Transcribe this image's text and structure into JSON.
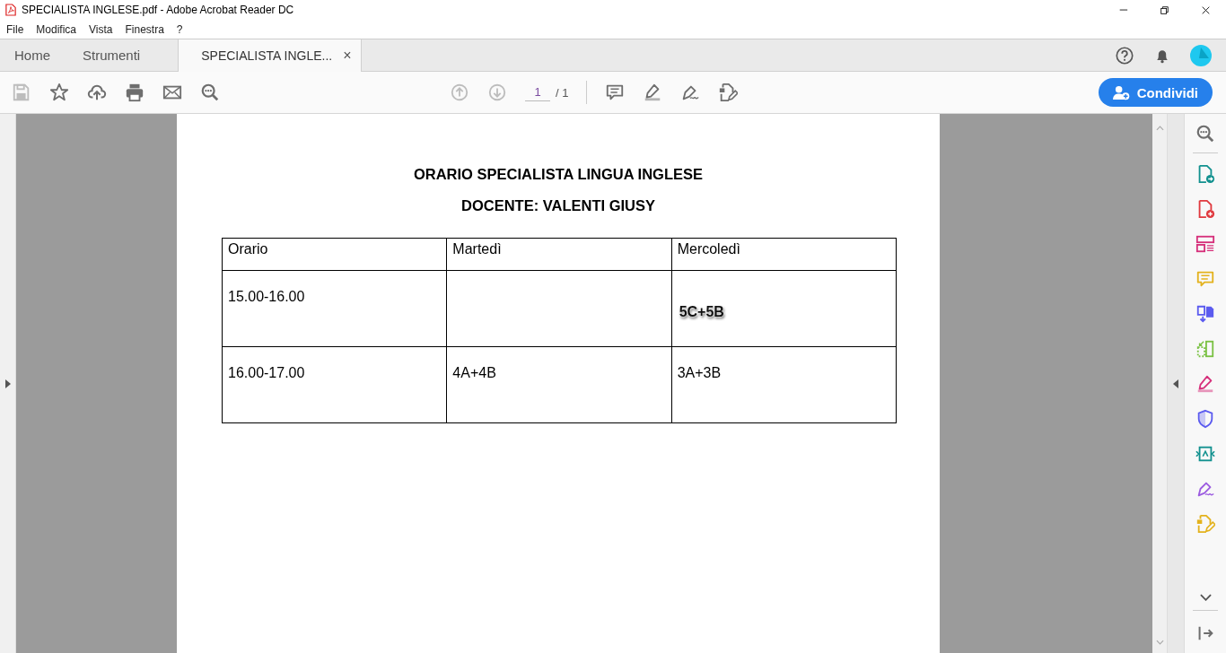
{
  "window": {
    "title": "SPECIALISTA INGLESE.pdf - Adobe Acrobat Reader DC"
  },
  "menu": [
    "File",
    "Modifica",
    "Vista",
    "Finestra",
    "?"
  ],
  "tabs": [
    {
      "label": "Home",
      "selected": false
    },
    {
      "label": "Strumenti",
      "selected": false
    },
    {
      "label": "SPECIALISTA INGLE...",
      "selected": true,
      "close": "×"
    }
  ],
  "toolbar": {
    "tools": [
      {
        "kind": "save",
        "disabled": true
      },
      {
        "kind": "star",
        "disabled": false
      },
      {
        "kind": "upload",
        "disabled": false
      },
      {
        "kind": "print",
        "disabled": false
      },
      {
        "kind": "mail",
        "disabled": false
      },
      {
        "kind": "zoom",
        "disabled": false
      }
    ],
    "nav": [
      {
        "kind": "up",
        "disabled": true
      },
      {
        "kind": "down",
        "disabled": true
      }
    ],
    "page_number": "1",
    "page_total": "/ 1",
    "annot": [
      {
        "kind": "comment"
      },
      {
        "kind": "highlight"
      },
      {
        "kind": "sign"
      },
      {
        "kind": "fill"
      }
    ],
    "share_button": "Condividi"
  },
  "document": {
    "title": "ORARIO SPECIALISTA LINGUA INGLESE",
    "subtitle": "DOCENTE: VALENTI GIUSY",
    "table": {
      "columns": [
        "Orario",
        "Martedì",
        "Mercoledì"
      ],
      "rows": [
        [
          {
            "kind": "plain",
            "text": "15.00-16.00"
          },
          {
            "kind": "empty"
          },
          {
            "kind": "outlined",
            "text": "5C+5B"
          }
        ],
        [
          {
            "kind": "plain",
            "text": "16.00-17.00"
          },
          {
            "kind": "plain",
            "text": "4A+4B"
          },
          {
            "kind": "plain",
            "text": "3A+3B"
          }
        ]
      ]
    }
  },
  "right_panel": [
    {
      "kind": "zoom"
    },
    {
      "kind": "export",
      "color": "#12918f"
    },
    {
      "kind": "create",
      "color": "#e0393e"
    },
    {
      "kind": "organize",
      "color": "#d6307b"
    },
    {
      "kind": "comment",
      "color": "#e3b21d"
    },
    {
      "kind": "combine",
      "color": "#5b5bef"
    },
    {
      "kind": "compress",
      "color": "#7ac143"
    },
    {
      "kind": "highlight",
      "color": "#d6307b"
    },
    {
      "kind": "protect",
      "color": "#5b5bef"
    },
    {
      "kind": "convert",
      "color": "#12918f"
    },
    {
      "kind": "sign",
      "color": "#9c5ce0"
    },
    {
      "kind": "fill",
      "color": "#e3b21d"
    }
  ]
}
